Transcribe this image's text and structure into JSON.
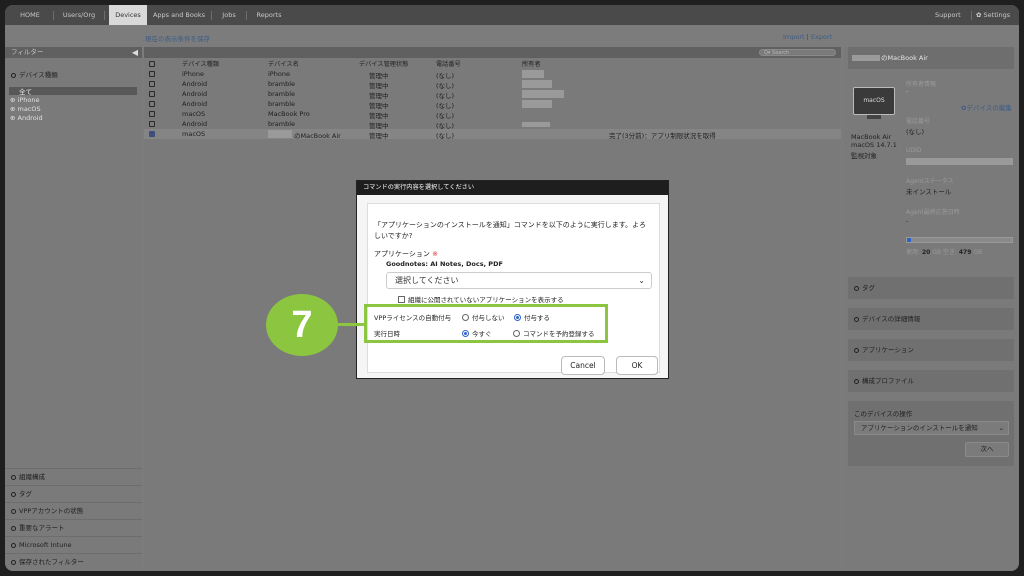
{
  "nav": {
    "home": "HOME",
    "users": "Users/Org",
    "devices": "Devices",
    "apps": "Apps and Books",
    "jobs": "Jobs",
    "reports": "Reports",
    "support": "Support",
    "settings": "Settings"
  },
  "links": {
    "save_filter": "現在の表示条件を保存",
    "import": "Import",
    "export": "Export",
    "sep": "|"
  },
  "sidebar": {
    "header": "フィルター",
    "device_type": "デバイス種類",
    "platforms": [
      "全て",
      "iPhone",
      "macOS",
      "Android"
    ],
    "bottom": [
      "組織構成",
      "タグ",
      "VPPアカウントの状態",
      "重要なアラート",
      "Microsoft Intune",
      "保存されたフィルター"
    ]
  },
  "table": {
    "search_placeholder": "Search",
    "columns": [
      "デバイス種類",
      "デバイス名",
      "デバイス管理状態",
      "電話番号",
      "所有者"
    ],
    "rows": [
      {
        "type": "iPhone",
        "name": "iPhone",
        "status": "管理中",
        "phone": "(なし)",
        "note": "",
        "checked": false
      },
      {
        "type": "Android",
        "name": "bramble",
        "status": "管理中",
        "phone": "(なし)",
        "note": "",
        "checked": false
      },
      {
        "type": "Android",
        "name": "bramble",
        "status": "管理中",
        "phone": "(なし)",
        "note": "",
        "checked": false
      },
      {
        "type": "Android",
        "name": "bramble",
        "status": "管理中",
        "phone": "(なし)",
        "note": "",
        "checked": false
      },
      {
        "type": "macOS",
        "name": "MacBook Pro",
        "status": "管理中",
        "phone": "(なし)",
        "note": "",
        "checked": false
      },
      {
        "type": "Android",
        "name": "bramble",
        "status": "管理中",
        "phone": "(なし)",
        "note": "",
        "checked": false
      },
      {
        "type": "macOS",
        "name": "のMacBook Air",
        "status": "管理中",
        "phone": "(なし)",
        "note": "完了(3分前)：アプリ制限状況を取得",
        "checked": true
      }
    ]
  },
  "detail": {
    "title": "のMacBook Air",
    "owner_label": "所有者情報",
    "owner_value": "-",
    "edit_link": "デバイスの編集",
    "phone_label": "電話番号",
    "phone_value": "(なし)",
    "udid_label": "UDID",
    "os_badge": "macOS",
    "model": "MacBook Air",
    "os_version": "macOS 14.7.1",
    "supervised": "監視対象",
    "agent_status_label": "Agentステータス",
    "agent_status_value": "未インストール",
    "agent_last_label": "Agent最終応答日時",
    "agent_last_value": "-",
    "storage_used_label": "使用:",
    "storage_used": "20",
    "storage_free_label": "空き:",
    "storage_free": "479",
    "storage_unit": "GB",
    "storage_used_fraction": 0.04,
    "sections": [
      "タグ",
      "デバイスの詳細情報",
      "アプリケーション",
      "構成プロファイル"
    ],
    "ops_label": "このデバイスの操作",
    "ops_select": "アプリケーションのインストールを通知",
    "next_button": "次へ"
  },
  "modal": {
    "title": "コマンドの実行内容を選択してください",
    "question": "「アプリケーションのインストールを通知」コマンドを以下のように実行します。よろしいですか?",
    "app_label": "アプリケーション",
    "required_mark": "※",
    "app_name": "Goodnotes: AI Notes, Docs, PDF",
    "select_placeholder": "選択してください",
    "show_unpublished": "組織に公開されていないアプリケーションを表示する",
    "vpp_label": "VPPライセンスの自動付与",
    "vpp_no": "付与しない",
    "vpp_yes": "付与する",
    "vpp_selected": "付与する",
    "exec_label": "実行日時",
    "exec_now": "今すぐ",
    "exec_schedule": "コマンドを予約登録する",
    "exec_selected": "今すぐ",
    "cancel": "Cancel",
    "ok": "OK"
  },
  "step_badge": "7",
  "colors": {
    "highlight": "#8cc540",
    "topbar": "#4a4a4a",
    "link": "#3d5c86",
    "radio": "#2f62c8"
  }
}
